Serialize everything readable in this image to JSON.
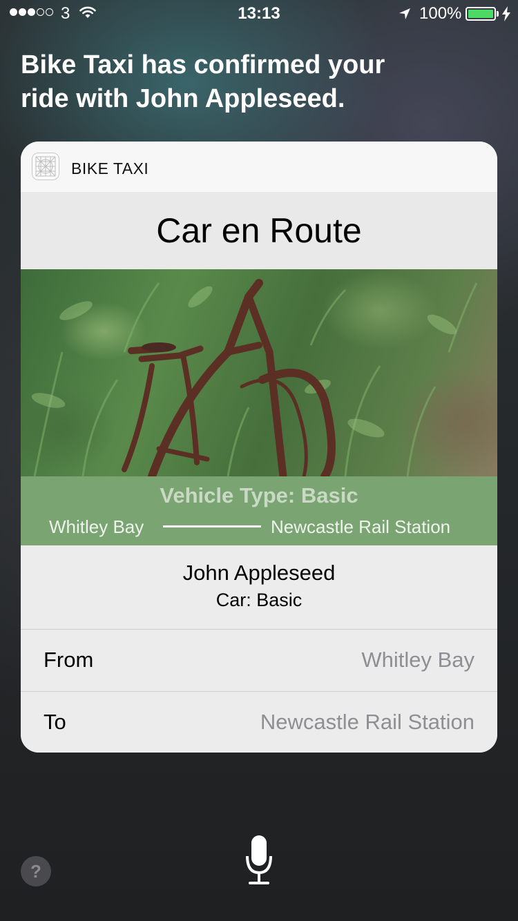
{
  "status_bar": {
    "signal_strength": 3,
    "signal_max": 5,
    "carrier": "3",
    "time": "13:13",
    "battery": "100%",
    "battery_level": 1.0,
    "icons": [
      "signal-dots-icon",
      "wifi-icon",
      "location-arrow-icon",
      "battery-icon",
      "charging-bolt-icon"
    ]
  },
  "siri": {
    "response": "Bike Taxi has confirmed your ride with John Appleseed."
  },
  "card": {
    "app_name": "BIKE TAXI",
    "title": "Car en Route",
    "vehicle_type": "Vehicle Type: Basic",
    "route_from": "Whitley Bay",
    "route_to": "Newcastle Rail Station",
    "driver_name": "John Appleseed",
    "car": "Car: Basic",
    "rows": [
      {
        "label": "From",
        "value": "Whitley Bay"
      },
      {
        "label": "To",
        "value": "Newcastle Rail Station"
      }
    ]
  },
  "footer": {
    "help_label": "?",
    "icons": [
      "microphone-icon"
    ]
  },
  "colors": {
    "battery_green": "#4cd964",
    "banner_green": "#709e68",
    "secondary_text": "#8e8e93"
  }
}
